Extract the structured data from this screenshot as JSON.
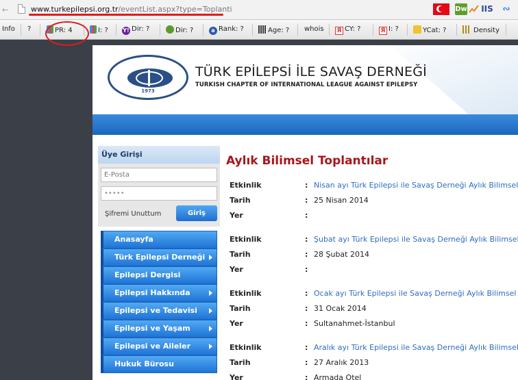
{
  "address_bar": {
    "url_host": "www.turkepilepsi.org.tr",
    "url_path": "/eventList.aspx?type=Toplanti",
    "back_glyph": "←",
    "ext_dw": "Dw",
    "ext_iis": "IIS",
    "ext_wave": "∾"
  },
  "seo_toolbar": {
    "info": "Info",
    "q": "?",
    "pr": "PR: 4",
    "index": "I: ?",
    "ydir": "Dir: ?",
    "dmoz": "Dir: ?",
    "rank": "Rank: ?",
    "age": "Age: ?",
    "whois": "whois",
    "cy": "CY: ?",
    "yi": "I: ?",
    "ycat": "YCat: ?",
    "density": "Density",
    "yahoo_glyph": "Y!",
    "alexa_glyph": "a",
    "yandex_glyph": "Я"
  },
  "colors": {
    "accent_blue": "#1f74d6",
    "title_red": "#a8161b",
    "link_blue": "#2f6cc0",
    "annotation_red": "#e01b1b"
  },
  "header": {
    "org_name_tr": "TÜRK EPİLEPSİ İLE SAVAŞ DERNEĞİ",
    "org_name_en": "TURKISH CHAPTER OF INTERNATIONAL LEAGUE AGAINST EPILEPSY",
    "seal_year": "1973"
  },
  "login": {
    "title": "Üye Girişi",
    "email_placeholder": "E-Posta",
    "password_value": "•••••",
    "forgot": "Şifremi Unuttum",
    "submit": "Giriş"
  },
  "menu": [
    {
      "label": "Anasayfa",
      "arrow": false
    },
    {
      "label": "Türk Epilepsi Derneği",
      "arrow": true
    },
    {
      "label": "Epilepsi Dergisi",
      "arrow": false
    },
    {
      "label": "Epilepsi Hakkında",
      "arrow": true
    },
    {
      "label": "Epilepsi ve Tedavisi",
      "arrow": true
    },
    {
      "label": "Epilepsi ve Yaşam",
      "arrow": true
    },
    {
      "label": "Epilepsi ve Aileler",
      "arrow": true
    },
    {
      "label": "Hukuk Bürosu",
      "arrow": false
    }
  ],
  "main": {
    "title": "Aylık Bilimsel Toplantılar",
    "labels": {
      "event": "Etkinlik",
      "date": "Tarih",
      "place": "Yer",
      "colon": ":"
    },
    "events": [
      {
        "name": "Nisan ayı Türk Epilepsi ile Savaş Derneği Aylık Bilimsel",
        "date": "25 Nisan 2014",
        "place": ""
      },
      {
        "name": "Şubat ayı Türk Epilepsi ile Savaş Derneği Aylık Bilimsel",
        "date": "28 Şubat 2014",
        "place": ""
      },
      {
        "name": "Ocak ayı Türk Epilepsi ile Savaş Derneği Aylık Bilimsel",
        "date": "31 Ocak 2014",
        "place": "Sultanahmet-İstanbul"
      },
      {
        "name": "Aralık ayı Türk Epilepsi ile Savaş Derneği Aylık Bilimsel",
        "date": "27 Aralık 2013",
        "place": "Armada Otel"
      }
    ]
  }
}
